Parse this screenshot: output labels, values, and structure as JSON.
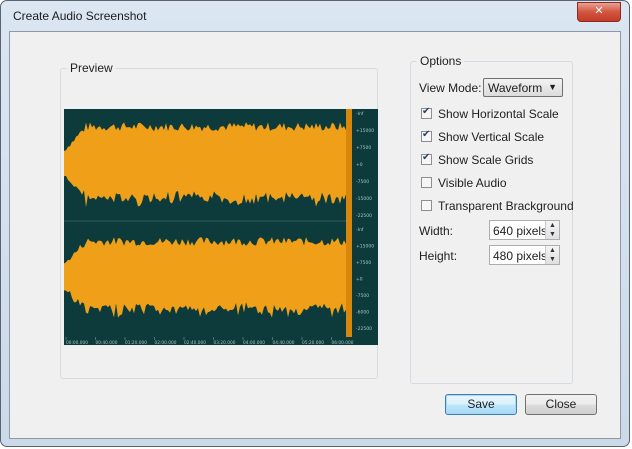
{
  "window": {
    "title": "Create Audio Screenshot",
    "close_glyph": "✕"
  },
  "preview": {
    "label": "Preview",
    "scale_labels_top": [
      "-Inf",
      "+15000",
      "+7500",
      "+0",
      "-7500",
      "-15000",
      "-22500"
    ],
    "scale_labels_bottom": [
      "-Inf",
      "+15000",
      "+7500",
      "+0",
      "-7500",
      "-6000",
      "-22500"
    ],
    "time_labels": [
      "00:00.000",
      "00:40.000",
      "01:20.000",
      "02:00.000",
      "02:40.000",
      "03:20.000",
      "04:00.000",
      "04:40.000",
      "05:20.000",
      "06:00.000"
    ],
    "colors": {
      "background": "#0d3a3a",
      "waveform": "#f0a018",
      "scale_bar": "#d9860c"
    }
  },
  "options": {
    "label": "Options",
    "view_mode_label": "View Mode:",
    "view_mode_value": "Waveform",
    "checkboxes": [
      {
        "label": "Show Horizontal Scale",
        "checked": true
      },
      {
        "label": "Show Vertical Scale",
        "checked": true
      },
      {
        "label": "Show Scale Grids",
        "checked": true
      },
      {
        "label": "Visible Audio",
        "checked": false
      },
      {
        "label": "Transparent Brackground",
        "checked": false
      }
    ],
    "width_label": "Width:",
    "width_value": "640 pixels",
    "height_label": "Height:",
    "height_value": "480 pixels"
  },
  "buttons": {
    "save": "Save",
    "close": "Close"
  }
}
